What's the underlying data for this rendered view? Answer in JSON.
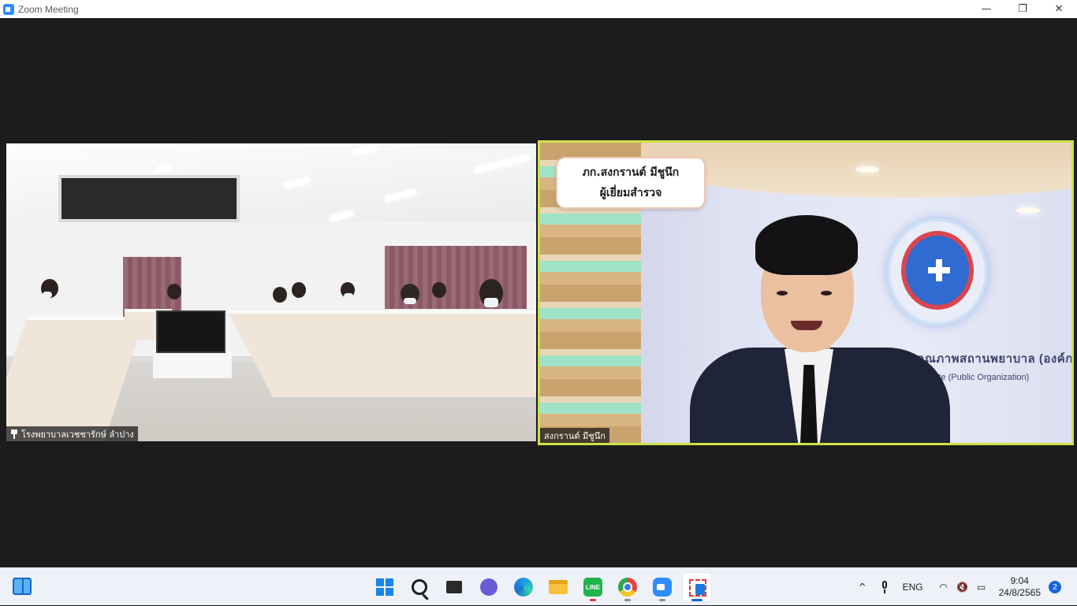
{
  "window": {
    "title": "Zoom Meeting",
    "minimize_glyph": "—",
    "maximize_glyph": "❐",
    "close_glyph": "✕"
  },
  "participants": [
    {
      "name": "โรงพยาบาลเวชชารักษ์ ลำปาง",
      "pinned": true,
      "active_speaker": false
    },
    {
      "name": "สงกรานต์ มีชูนึก",
      "pinned": false,
      "active_speaker": true
    }
  ],
  "video_overlay": {
    "name_card_line1": "ภก.สงกรานต์ มีชูนึก",
    "name_card_line2": "ผู้เยี่ยมสำรวจ",
    "wall_sign_line1": "สถาบันรับรองคุณภาพสถานพยาบาล (องค์การมหาชน)",
    "wall_sign_line2": "Institute (Public Organization)"
  },
  "taskbar": {
    "pinned_apps": [
      "start-icon",
      "search-icon",
      "task-view-icon",
      "chat-icon",
      "edge-icon",
      "file-explorer-icon",
      "line-icon",
      "chrome-icon",
      "zoom-icon",
      "snipping-tool-icon"
    ],
    "line_label": "LINE",
    "tray": {
      "chevron": "^",
      "language": "ENG",
      "wifi_glyph": "◠",
      "volume_glyph": "🔇",
      "battery_glyph": "▭",
      "time": "9:04",
      "date": "24/8/2565",
      "notification_count": "2"
    }
  },
  "colors": {
    "active_speaker_border": "#cfe04a",
    "meeting_background": "#1c1c1c",
    "taskbar_background": "#eef1f7",
    "accent": "#1566d8"
  }
}
